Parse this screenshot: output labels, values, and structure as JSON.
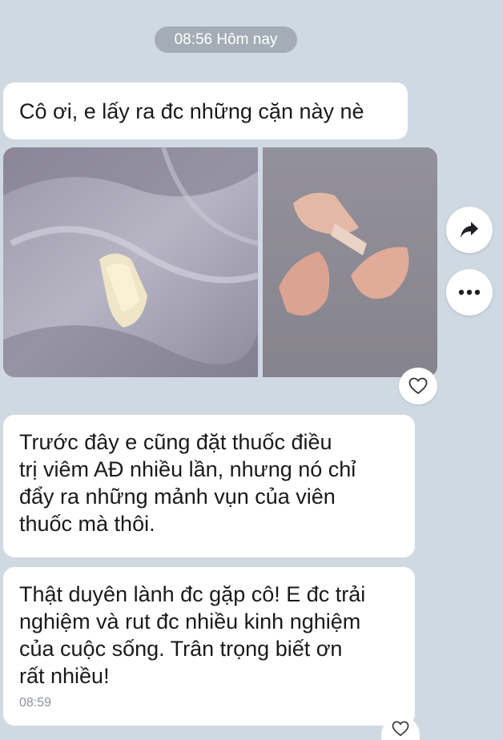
{
  "header": {
    "date_pill": "08:56 Hôm nay"
  },
  "messages": [
    {
      "lines": [
        "Cô ơi, e lấy ra đc những cặn này nè"
      ]
    },
    {
      "type": "photos",
      "count": 2
    },
    {
      "lines": [
        "Trước đây e cũng đặt thuốc điều",
        "trị viêm AĐ nhiều lần, nhưng nó chỉ",
        "đẩy ra những mảnh vụn của viên",
        "thuốc mà thôi."
      ]
    },
    {
      "lines": [
        "Thật duyên lành đc gặp cô! E đc trải",
        "nghiệm và rut đc nhiều kinh nghiệm",
        "của cuộc sống. Trân trọng biết ơn",
        "rất nhiều!"
      ],
      "time": "08:59"
    }
  ],
  "actions": {
    "share_icon": "share-arrow-icon",
    "more_icon": "more-horizontal-icon",
    "react_icon": "heart-outline-icon"
  },
  "colors": {
    "background": "#cfd9e2",
    "bubble": "#ffffff",
    "pill": "#a4adb6",
    "timestamp": "#8a939b"
  }
}
